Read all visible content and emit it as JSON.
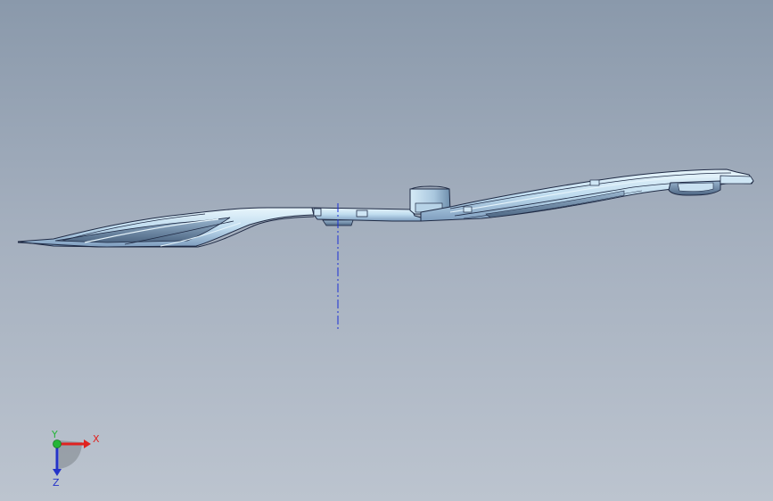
{
  "viewport": {
    "background_top": "#8a99ab",
    "background_bottom": "#bcc4cf"
  },
  "model": {
    "type": "sheet-metal part, side view",
    "edge_color": "#1f2a44",
    "face_color": "#cfe6f5",
    "highlight_color": "#e6f4fb",
    "shadow_color": "#6f8fb0"
  },
  "centerline": {
    "color": "#1a2fd6",
    "style": "dash-dot"
  },
  "triad": {
    "x_label": "X",
    "y_label": "Y",
    "z_label": "Z",
    "x_color": "#e0221f",
    "y_color": "#24b538",
    "z_color": "#2433c9"
  }
}
